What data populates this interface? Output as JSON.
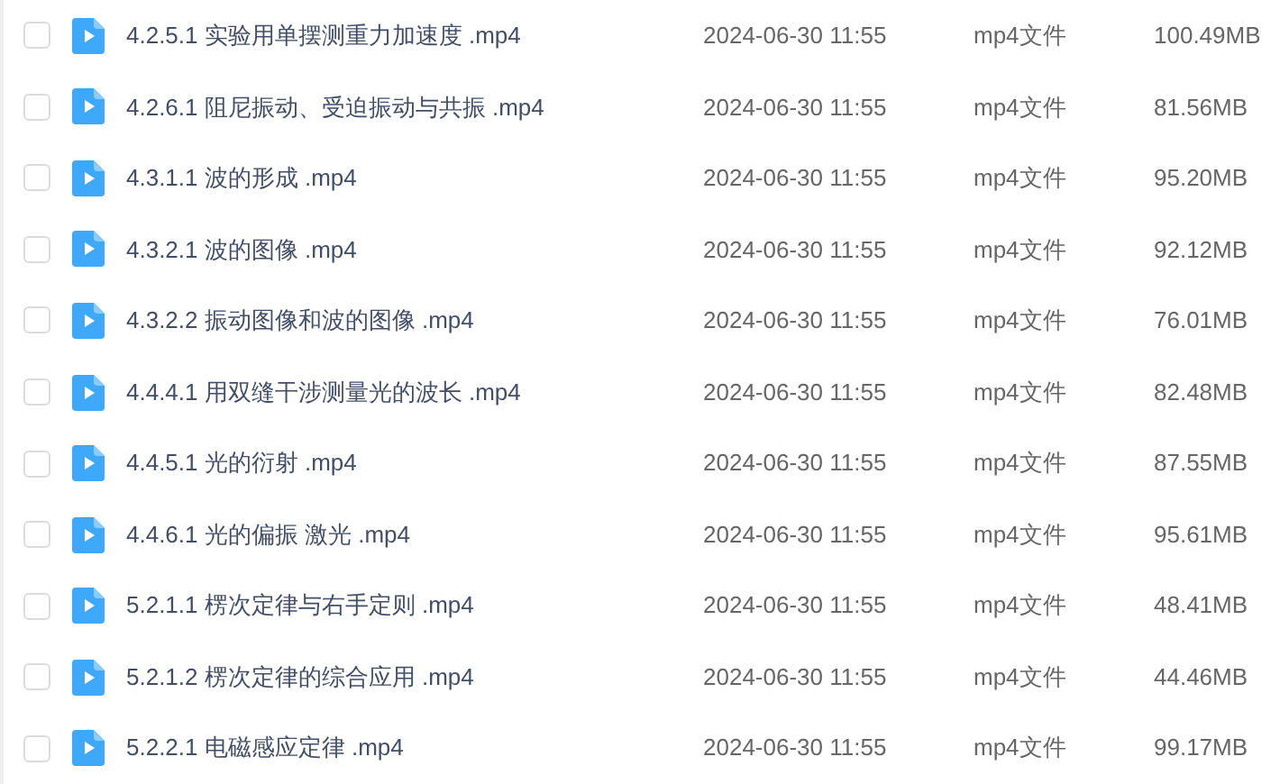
{
  "files": [
    {
      "name": "4.2.5.1 实验用单摆测重力加速度 .mp4",
      "modified": "2024-06-30 11:55",
      "type": "mp4文件",
      "size": "100.49MB",
      "selected": false
    },
    {
      "name": "4.2.6.1 阻尼振动、受迫振动与共振 .mp4",
      "modified": "2024-06-30 11:55",
      "type": "mp4文件",
      "size": "81.56MB",
      "selected": false
    },
    {
      "name": "4.3.1.1 波的形成 .mp4",
      "modified": "2024-06-30 11:55",
      "type": "mp4文件",
      "size": "95.20MB",
      "selected": false
    },
    {
      "name": "4.3.2.1 波的图像 .mp4",
      "modified": "2024-06-30 11:55",
      "type": "mp4文件",
      "size": "92.12MB",
      "selected": false
    },
    {
      "name": "4.3.2.2 振动图像和波的图像 .mp4",
      "modified": "2024-06-30 11:55",
      "type": "mp4文件",
      "size": "76.01MB",
      "selected": false
    },
    {
      "name": "4.4.4.1 用双缝干涉测量光的波长 .mp4",
      "modified": "2024-06-30 11:55",
      "type": "mp4文件",
      "size": "82.48MB",
      "selected": false
    },
    {
      "name": "4.4.5.1 光的衍射 .mp4",
      "modified": "2024-06-30 11:55",
      "type": "mp4文件",
      "size": "87.55MB",
      "selected": false
    },
    {
      "name": "4.4.6.1 光的偏振 激光 .mp4",
      "modified": "2024-06-30 11:55",
      "type": "mp4文件",
      "size": "95.61MB",
      "selected": false
    },
    {
      "name": "5.2.1.1 楞次定律与右手定则 .mp4",
      "modified": "2024-06-30 11:55",
      "type": "mp4文件",
      "size": "48.41MB",
      "selected": false
    },
    {
      "name": "5.2.1.2 楞次定律的综合应用 .mp4",
      "modified": "2024-06-30 11:55",
      "type": "mp4文件",
      "size": "44.46MB",
      "selected": false
    },
    {
      "name": "5.2.2.1 电磁感应定律 .mp4",
      "modified": "2024-06-30 11:55",
      "type": "mp4文件",
      "size": "99.17MB",
      "selected": false
    }
  ]
}
